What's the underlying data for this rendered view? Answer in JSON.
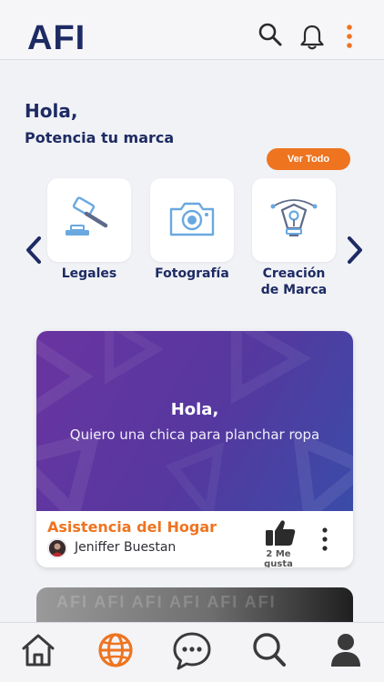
{
  "header": {
    "logo": "AFI"
  },
  "greeting": {
    "title": "Hola,",
    "subtitle": "Potencia tu marca"
  },
  "ver_todo_label": "Ver Todo",
  "categories": [
    {
      "label": "Legales",
      "icon": "gavel-icon"
    },
    {
      "label": "Fotografía",
      "icon": "camera-icon"
    },
    {
      "label": "Creación de Marca",
      "icon": "pen-tool-icon"
    }
  ],
  "post": {
    "greeting": "Hola,",
    "message": "Quiero una chica para planchar ropa",
    "category": "Asistencia del Hogar",
    "author": "Jeniffer Buestan",
    "likes": "2 Me gusta"
  },
  "post2": {
    "watermark": "AFI AFI AFI AFI AFI AFI"
  },
  "colors": {
    "brand_navy": "#1e2b63",
    "accent_orange": "#ee7420",
    "icon_blue": "#6aa8e0"
  },
  "bottom_nav": [
    "home-icon",
    "globe-icon",
    "chat-icon",
    "search-icon",
    "profile-icon"
  ]
}
